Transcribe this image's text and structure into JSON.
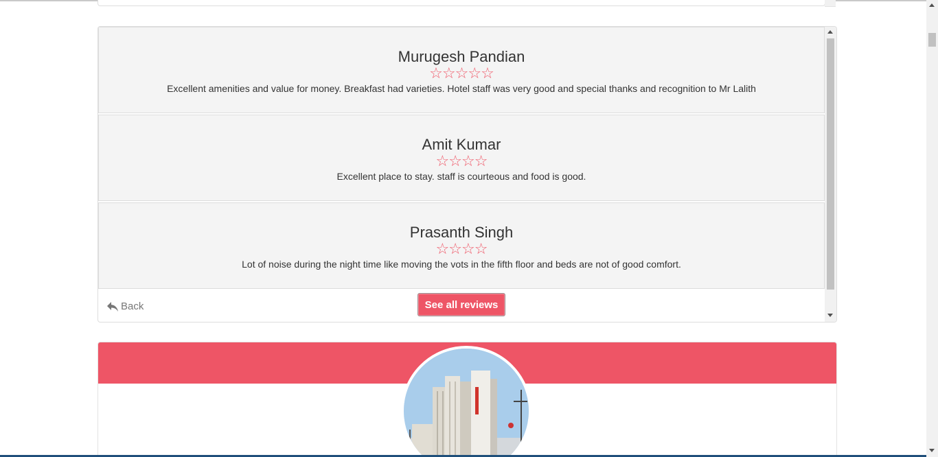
{
  "reviews": [
    {
      "name": "Murugesh Pandian",
      "rating": 5,
      "text": "Excellent amenities and value for money. Breakfast had varieties. Hotel staff was very good and special thanks and recognition to Mr Lalith"
    },
    {
      "name": "Amit Kumar",
      "rating": 4,
      "text": "Excellent place to stay. staff is courteous and food is good."
    },
    {
      "name": "Prasanth Singh",
      "rating": 4,
      "text": "Lot of noise during the night time like moving the vots in the fifth floor and beds are not of good comfort."
    }
  ],
  "footer": {
    "back_label": "Back",
    "see_all_label": "See all reviews"
  },
  "colors": {
    "accent": "#ee5566",
    "star": "#ef5a6a",
    "card_bg": "#f4f4f4"
  },
  "icons": {
    "back": "reply-arrow-icon",
    "star": "star-outline-icon"
  }
}
